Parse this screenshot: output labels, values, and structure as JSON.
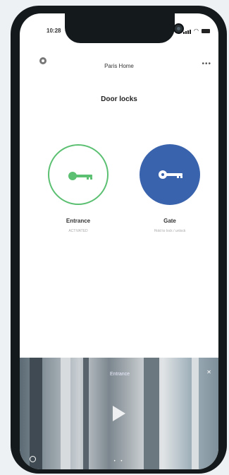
{
  "status_bar": {
    "time": "10:28"
  },
  "header": {
    "title": "Paris Home",
    "more": "•••"
  },
  "section": {
    "title": "Door locks"
  },
  "locks": [
    {
      "name": "Entrance",
      "status": "ACTIVATED",
      "color": "#5cc072"
    },
    {
      "name": "Gate",
      "status": "Hold to lock / unlock",
      "color": "#3a63ad"
    }
  ],
  "camera": {
    "label": "Entrance",
    "close": "✕",
    "dots": "• •"
  }
}
